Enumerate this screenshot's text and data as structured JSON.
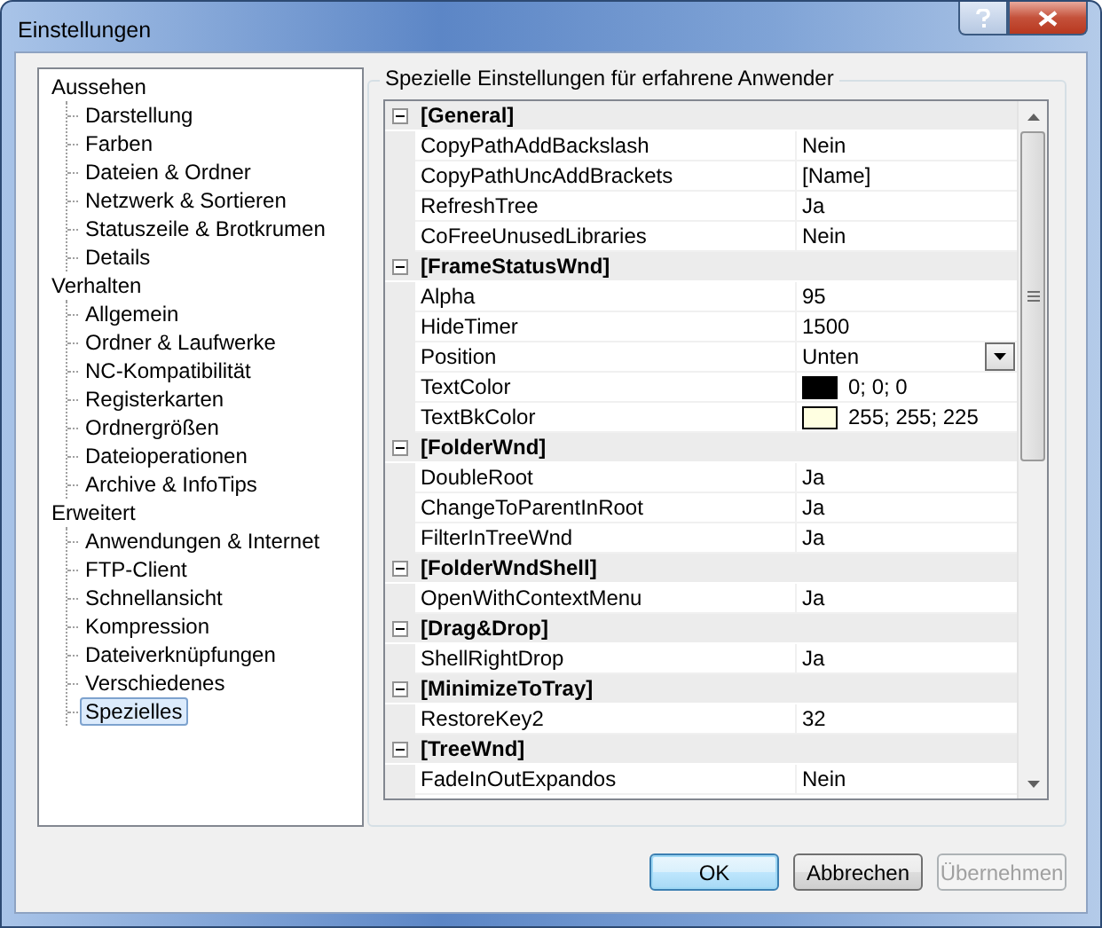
{
  "window": {
    "title": "Einstellungen"
  },
  "sidebar": {
    "items": [
      {
        "label": "Aussehen",
        "selected": false,
        "children": [
          {
            "label": "Darstellung",
            "selected": false
          },
          {
            "label": "Farben",
            "selected": false
          },
          {
            "label": "Dateien & Ordner",
            "selected": false
          },
          {
            "label": "Netzwerk & Sortieren",
            "selected": false
          },
          {
            "label": "Statuszeile & Brotkrumen",
            "selected": false
          },
          {
            "label": "Details",
            "selected": false
          }
        ]
      },
      {
        "label": "Verhalten",
        "selected": false,
        "children": [
          {
            "label": "Allgemein",
            "selected": false
          },
          {
            "label": "Ordner & Laufwerke",
            "selected": false
          },
          {
            "label": "NC-Kompatibilität",
            "selected": false
          },
          {
            "label": "Registerkarten",
            "selected": false
          },
          {
            "label": "Ordnergrößen",
            "selected": false
          },
          {
            "label": "Dateioperationen",
            "selected": false
          },
          {
            "label": "Archive & InfoTips",
            "selected": false
          }
        ]
      },
      {
        "label": "Erweitert",
        "selected": false,
        "children": [
          {
            "label": "Anwendungen & Internet",
            "selected": false
          },
          {
            "label": "FTP-Client",
            "selected": false
          },
          {
            "label": "Schnellansicht",
            "selected": false
          },
          {
            "label": "Kompression",
            "selected": false
          },
          {
            "label": "Dateiverknüpfungen",
            "selected": false
          },
          {
            "label": "Verschiedenes",
            "selected": false
          },
          {
            "label": "Spezielles",
            "selected": true
          }
        ]
      }
    ]
  },
  "group": {
    "title": "Spezielle Einstellungen für erfahrene Anwender"
  },
  "sections": [
    {
      "name": "[General]",
      "expanded": true,
      "rows": [
        {
          "name": "CopyPathAddBackslash",
          "value": "Nein",
          "kind": "text"
        },
        {
          "name": "CopyPathUncAddBrackets",
          "value": "[Name]",
          "kind": "text"
        },
        {
          "name": "RefreshTree",
          "value": "Ja",
          "kind": "text"
        },
        {
          "name": "CoFreeUnusedLibraries",
          "value": "Nein",
          "kind": "text"
        }
      ]
    },
    {
      "name": "[FrameStatusWnd]",
      "expanded": true,
      "rows": [
        {
          "name": "Alpha",
          "value": "95",
          "kind": "text"
        },
        {
          "name": "HideTimer",
          "value": "1500",
          "kind": "text"
        },
        {
          "name": "Position",
          "value": "Unten",
          "kind": "dropdown",
          "selected": true
        },
        {
          "name": "TextColor",
          "value": "0; 0; 0",
          "kind": "color",
          "color": "#000000"
        },
        {
          "name": "TextBkColor",
          "value": "255; 255; 225",
          "kind": "color",
          "color": "#ffffe1"
        }
      ]
    },
    {
      "name": "[FolderWnd]",
      "expanded": true,
      "rows": [
        {
          "name": "DoubleRoot",
          "value": "Ja",
          "kind": "text"
        },
        {
          "name": "ChangeToParentInRoot",
          "value": "Ja",
          "kind": "text"
        },
        {
          "name": "FilterInTreeWnd",
          "value": "Ja",
          "kind": "text"
        }
      ]
    },
    {
      "name": "[FolderWndShell]",
      "expanded": true,
      "rows": [
        {
          "name": "OpenWithContextMenu",
          "value": "Ja",
          "kind": "text"
        }
      ]
    },
    {
      "name": "[Drag&Drop]",
      "expanded": true,
      "rows": [
        {
          "name": "ShellRightDrop",
          "value": "Ja",
          "kind": "text"
        }
      ]
    },
    {
      "name": "[MinimizeToTray]",
      "expanded": true,
      "rows": [
        {
          "name": "RestoreKey2",
          "value": "32",
          "kind": "text"
        }
      ]
    },
    {
      "name": "[TreeWnd]",
      "expanded": true,
      "rows": [
        {
          "name": "FadeInOutExpandos",
          "value": "Nein",
          "kind": "text"
        }
      ]
    }
  ],
  "buttons": [
    {
      "label": "OK",
      "kind": "default",
      "disabled": false
    },
    {
      "label": "Abbrechen",
      "kind": "normal",
      "disabled": false
    },
    {
      "label": "Übernehmen",
      "kind": "normal",
      "disabled": true
    }
  ]
}
